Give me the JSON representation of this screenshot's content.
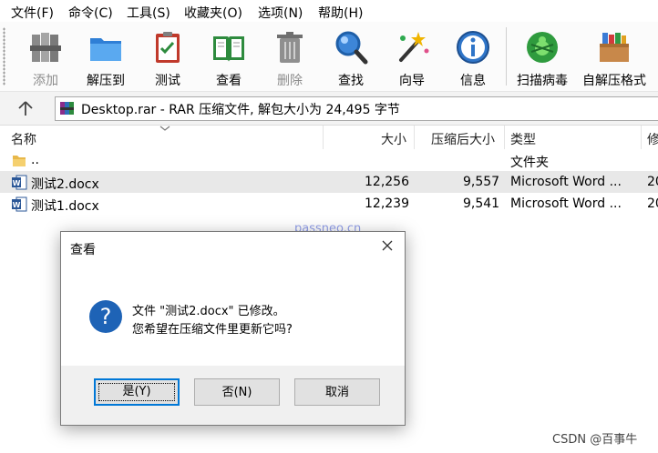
{
  "menu": [
    "文件(F)",
    "命令(C)",
    "工具(S)",
    "收藏夹(O)",
    "选项(N)",
    "帮助(H)"
  ],
  "toolbar": [
    {
      "label": "添加",
      "icon": "add-books-icon",
      "disabled": true
    },
    {
      "label": "解压到",
      "icon": "extract-folder-icon",
      "disabled": false
    },
    {
      "label": "测试",
      "icon": "test-clipboard-icon",
      "disabled": false
    },
    {
      "label": "查看",
      "icon": "view-book-icon",
      "disabled": false
    },
    {
      "label": "删除",
      "icon": "delete-trash-icon",
      "disabled": true
    },
    {
      "label": "查找",
      "icon": "find-magnifier-icon",
      "disabled": false
    },
    {
      "label": "向导",
      "icon": "wizard-wand-icon",
      "disabled": false
    },
    {
      "label": "信息",
      "icon": "info-icon",
      "disabled": false
    },
    {
      "label": "扫描病毒",
      "icon": "virus-scan-icon",
      "disabled": false
    },
    {
      "label": "自解压格式",
      "icon": "sfx-box-icon",
      "disabled": false
    }
  ],
  "address": {
    "path": "Desktop.rar - RAR 压缩文件, 解包大小为 24,495 字节"
  },
  "columns": {
    "name": "名称",
    "size": "大小",
    "packed": "压缩后大小",
    "type": "类型",
    "modified": "修"
  },
  "files": [
    {
      "name": "..",
      "size": "",
      "packed": "",
      "type": "文件夹",
      "kind": "folder"
    },
    {
      "name": "测试2.docx",
      "size": "12,256",
      "packed": "9,557",
      "type": "Microsoft Word ...",
      "modified": "20",
      "kind": "word"
    },
    {
      "name": "测试1.docx",
      "size": "12,239",
      "packed": "9,541",
      "type": "Microsoft Word ...",
      "modified": "20",
      "kind": "word"
    }
  ],
  "watermark": "passneo.cn",
  "credit": "CSDN @百事牛",
  "dialog": {
    "title": "查看",
    "message_line1": "文件 \"测试2.docx\" 已修改。",
    "message_line2": "您希望在压缩文件里更新它吗?",
    "yes": "是(Y)",
    "no": "否(N)",
    "cancel": "取消"
  }
}
